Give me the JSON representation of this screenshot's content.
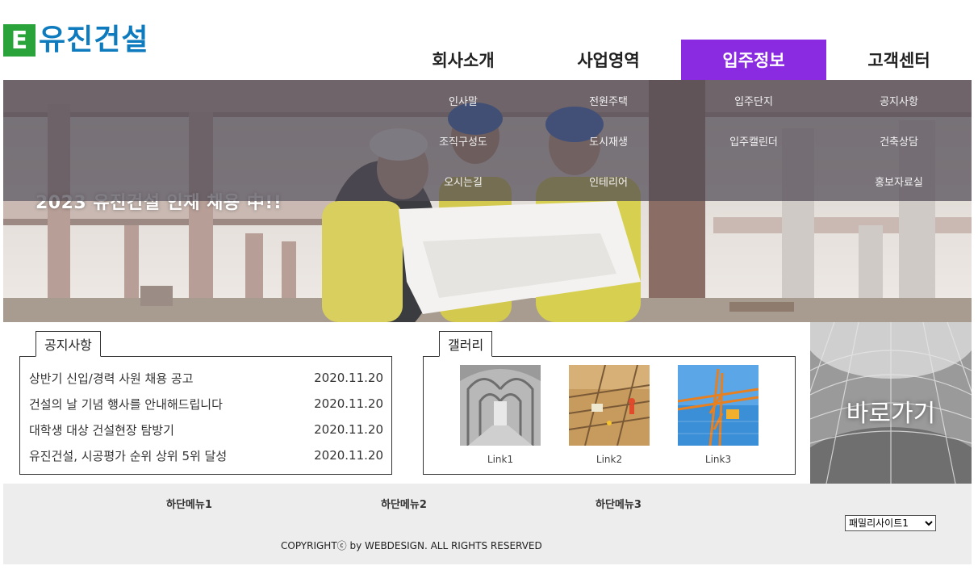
{
  "logo": {
    "mark": "E",
    "name": "유진건설"
  },
  "nav": [
    {
      "label": "회사소개",
      "active": false
    },
    {
      "label": "사업영역",
      "active": false
    },
    {
      "label": "입주정보",
      "active": true
    },
    {
      "label": "고객센터",
      "active": false
    }
  ],
  "submenu": [
    [
      "인사말",
      "조직구성도",
      "오시는길"
    ],
    [
      "전원주택",
      "도시재생",
      "인테리어"
    ],
    [
      "입주단지",
      "입주캘린더",
      ""
    ],
    [
      "공지사항",
      "건축상담",
      "홍보자료실"
    ]
  ],
  "hero": {
    "caption": "2023 유진건설 인재 채용 中!!"
  },
  "notice": {
    "title": "공지사항",
    "items": [
      {
        "text": "상반기 신입/경력 사원 채용 공고",
        "date": "2020.11.20"
      },
      {
        "text": "건설의 날 기념 행사를 안내해드립니다",
        "date": "2020.11.20"
      },
      {
        "text": "대학생 대상 건설현장 탐방기",
        "date": "2020.11.20"
      },
      {
        "text": "유진건설, 시공평가 순위 상위 5위 달성",
        "date": "2020.11.20"
      }
    ]
  },
  "gallery": {
    "title": "갤러리",
    "items": [
      {
        "caption": "Link1",
        "icon": "cloister-photo"
      },
      {
        "caption": "Link2",
        "icon": "construction-site-photo"
      },
      {
        "caption": "Link3",
        "icon": "crane-photo"
      }
    ]
  },
  "shortcut": {
    "label": "바로가기"
  },
  "footer": {
    "menus": [
      "하단메뉴1",
      "하단메뉴2",
      "하단메뉴3"
    ],
    "copyright": "COPYRIGHTⓒ by WEBDESIGN. ALL RIGHTS RESERVED",
    "family_select": "패밀리사이트1"
  },
  "colors": {
    "accent": "#8a2be2",
    "logo_green": "#2aa33a",
    "logo_blue": "#0d7bbd",
    "footer_bg": "#ededed"
  }
}
